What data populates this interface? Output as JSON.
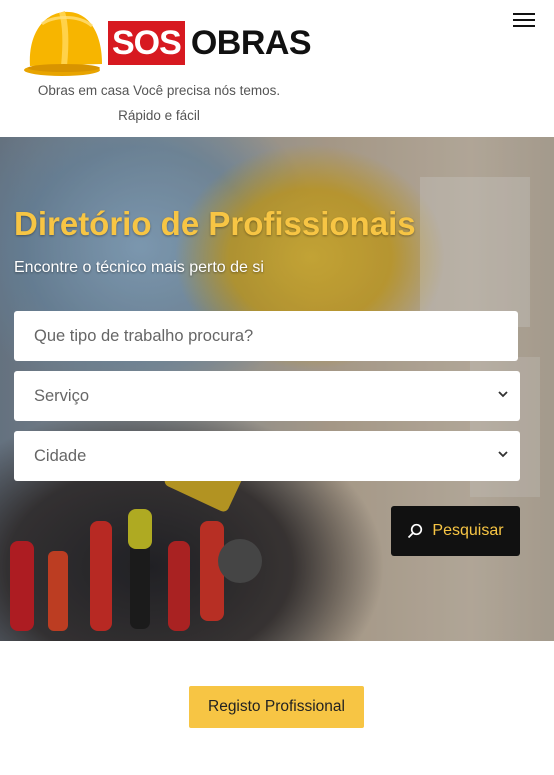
{
  "header": {
    "logo": {
      "sos": "SOS",
      "obras": "OBRAS",
      "icon": "hard-hat-icon"
    },
    "tagline_line1": "Obras em casa Você precisa nós temos.",
    "tagline_line2": "Rápido e fácil",
    "menu_icon": "hamburger-menu-icon"
  },
  "hero": {
    "title": "Diretório de Profissionais",
    "subtitle": "Encontre o técnico mais perto de si",
    "search_placeholder": "Que tipo de trabalho procura?",
    "service_select": {
      "selected": "Serviço",
      "icon": "chevron-down-icon"
    },
    "city_select": {
      "selected": "Cidade",
      "icon": "chevron-down-icon"
    },
    "search_button": {
      "label": "Pesquisar",
      "icon": "search-icon"
    }
  },
  "footer_cta": {
    "label": "Registo Profissional"
  },
  "colors": {
    "accent_yellow": "#f7c544",
    "brand_red": "#d71920",
    "button_dark": "#111111"
  }
}
